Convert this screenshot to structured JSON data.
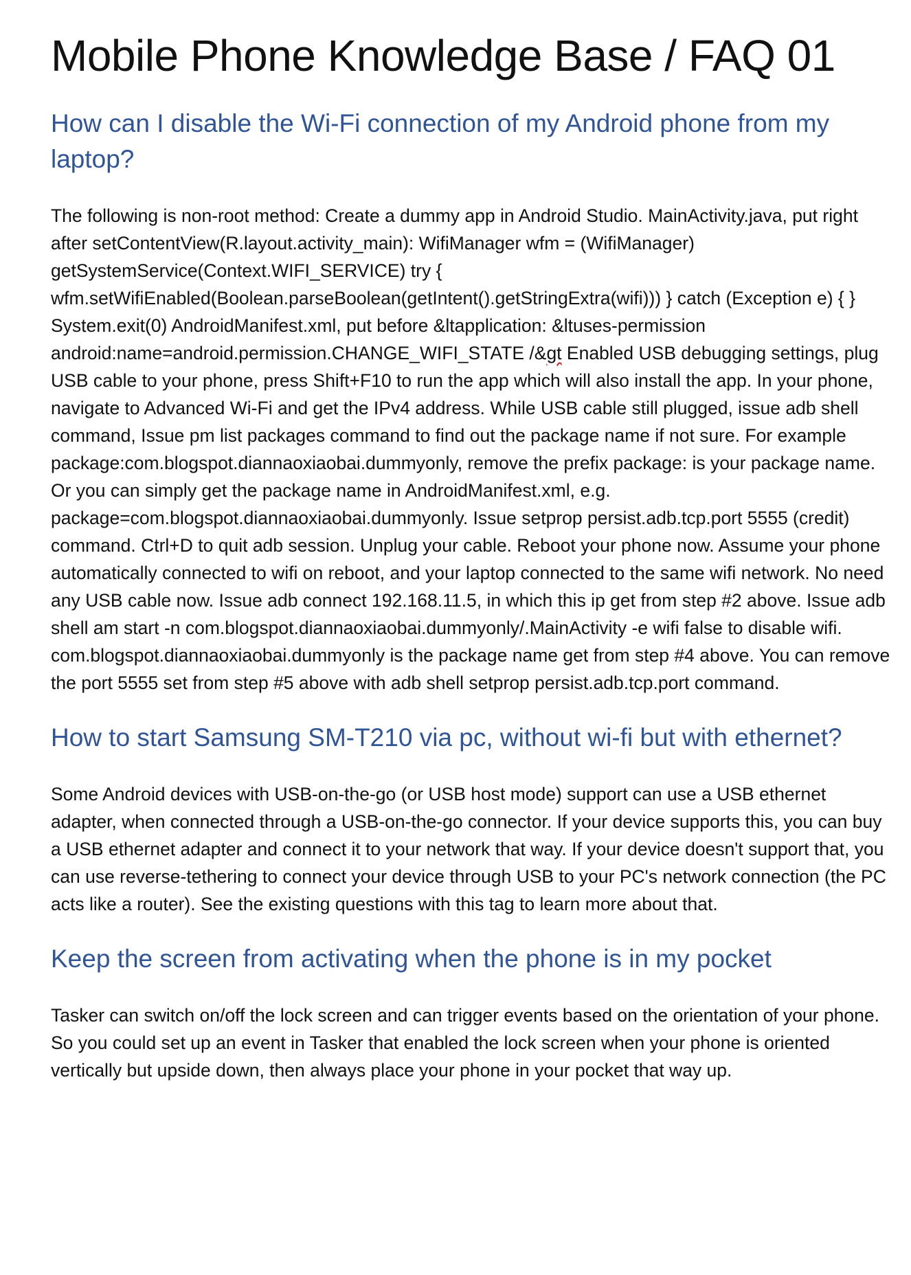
{
  "document": {
    "title": "Mobile Phone Knowledge Base / FAQ 01"
  },
  "colors": {
    "heading": "#2f5597",
    "body_text": "#111111",
    "spellcheck_underline": "#d02020"
  },
  "sections": [
    {
      "heading": "How can I disable the Wi-Fi connection of my Android phone from my laptop?",
      "body_before_mark": "The following is non-root method: Create a dummy app in Android Studio. MainActivity.java, put right after setContentView(R.layout.activity_main): WifiManager wfm = (WifiManager) getSystemService(Context.WIFI_SERVICE) try { wfm.setWifiEnabled(Boolean.parseBoolean(getIntent().getStringExtra(wifi))) } catch (Exception e) { } System.exit(0) AndroidManifest.xml, put before &ltapplication: &ltuses-permission android:name=android.permission.CHANGE_WIFI_STATE /&",
      "body_marked": "gt",
      "body_after_mark": " Enabled USB debugging settings, plug USB cable to your phone, press Shift+F10 to run the app which will also install the app. In your phone, navigate to Advanced Wi-Fi and get the IPv4 address. While USB cable still plugged, issue adb shell command, Issue pm list packages command to find out the package name if not sure. For example package:com.blogspot.diannaoxiaobai.dummyonly, remove the prefix package: is your package name. Or you can simply get the package name in AndroidManifest.xml, e.g. package=com.blogspot.diannaoxiaobai.dummyonly. Issue setprop persist.adb.tcp.port 5555 (credit) command. Ctrl+D to quit adb session. Unplug your cable. Reboot your phone now. Assume your phone automatically connected to wifi on reboot, and your laptop connected to the same wifi network. No need any USB cable now. Issue adb connect 192.168.11.5, in which this ip get from step #2 above. Issue adb shell am start -n com.blogspot.diannaoxiaobai.dummyonly/.MainActivity -e wifi false to disable wifi. com.blogspot.diannaoxiaobai.dummyonly is the package name get from step #4 above. You can remove the port 5555 set from step #5 above with adb shell setprop persist.adb.tcp.port command."
    },
    {
      "heading": "How to start Samsung SM-T210 via pc, without wi-fi but with ethernet?",
      "body": "Some Android devices with USB-on-the-go (or USB host mode) support can use a USB ethernet adapter, when connected through a USB-on-the-go connector. If your device supports this, you can buy a USB ethernet adapter and connect it to your network that way. If your device doesn't support that, you can use reverse-tethering to connect your device through USB to your PC's network connection (the PC acts like a router). See the existing questions with this tag to learn more about that."
    },
    {
      "heading": "Keep the screen from activating when the phone is in my pocket",
      "body": "Tasker can switch on/off the lock screen and can trigger events based on the orientation of your phone. So you could set up an event in Tasker that enabled the lock screen when your phone is oriented vertically but upside down, then always place your phone in your pocket that way up."
    }
  ]
}
